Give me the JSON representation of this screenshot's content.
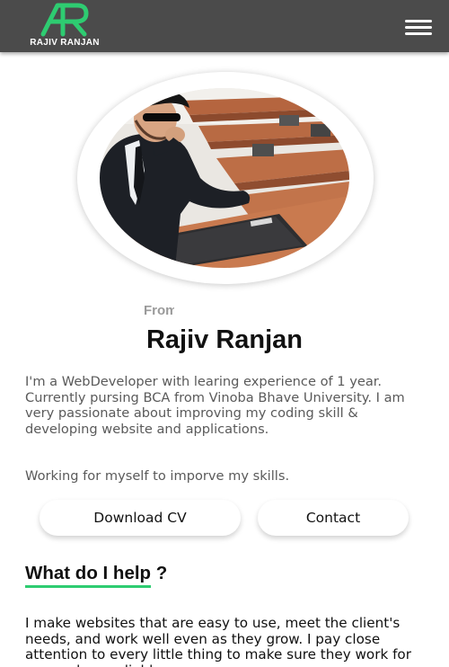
{
  "header": {
    "logo_text": "RAJIV RANJAN",
    "brand_color": "#2ecc71",
    "background": "#4b4b4b",
    "menu_icon": "hamburger-menu-icon"
  },
  "profile": {
    "from_text": "From",
    "name": "Rajiv Ranjan",
    "bio": "I'm a WebDeveloper with learing experience of 1 year. Currently pursing BCA from Vinoba Bhave University. I am very passionate about improving my coding skill & developing website and applications.",
    "bio_secondary": "Working for myself to imporve my skills."
  },
  "actions": {
    "download_cv_label": "Download CV",
    "contact_label": "Contact"
  },
  "help_section": {
    "title": "What do I help ?",
    "text": "I make websites that are easy to use, meet the client's needs, and work well even as they grow. I pay close attention to every little thing to make sure they work for you and are reliable."
  }
}
